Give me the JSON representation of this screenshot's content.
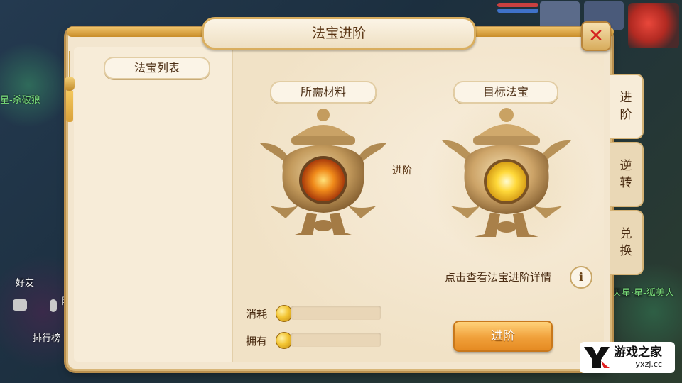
{
  "window": {
    "title": "法宝进阶",
    "close_icon": "close-icon"
  },
  "left_panel": {
    "header": "法宝列表"
  },
  "materials": {
    "header": "所需材料",
    "arrow_label": "进阶"
  },
  "target": {
    "header": "目标法宝"
  },
  "detail_link": "点击查看法宝进阶详情",
  "info_icon_glyph": "i",
  "resources": {
    "consume_label": "消耗",
    "own_label": "拥有",
    "consume_value": "",
    "own_value": "",
    "coin_icon": "gold-coin-icon"
  },
  "advance_button": "进阶",
  "side_tabs": [
    {
      "label": "进阶",
      "active": true
    },
    {
      "label": "逆转",
      "active": false
    },
    {
      "label": "兑换",
      "active": false
    }
  ],
  "background": {
    "player_name_left": "星-杀破狼",
    "player_name_right": "天星·星-狐美人",
    "friend": "好友",
    "rank": "排行榜",
    "side_text": "队"
  },
  "watermark": {
    "name": "游戏之家",
    "url": "yxzj.cc"
  },
  "colors": {
    "panel_bg": "#f3e6cf",
    "border_gold": "#d8b678",
    "button_orange": "#f0a03a",
    "close_red": "#d42020"
  }
}
